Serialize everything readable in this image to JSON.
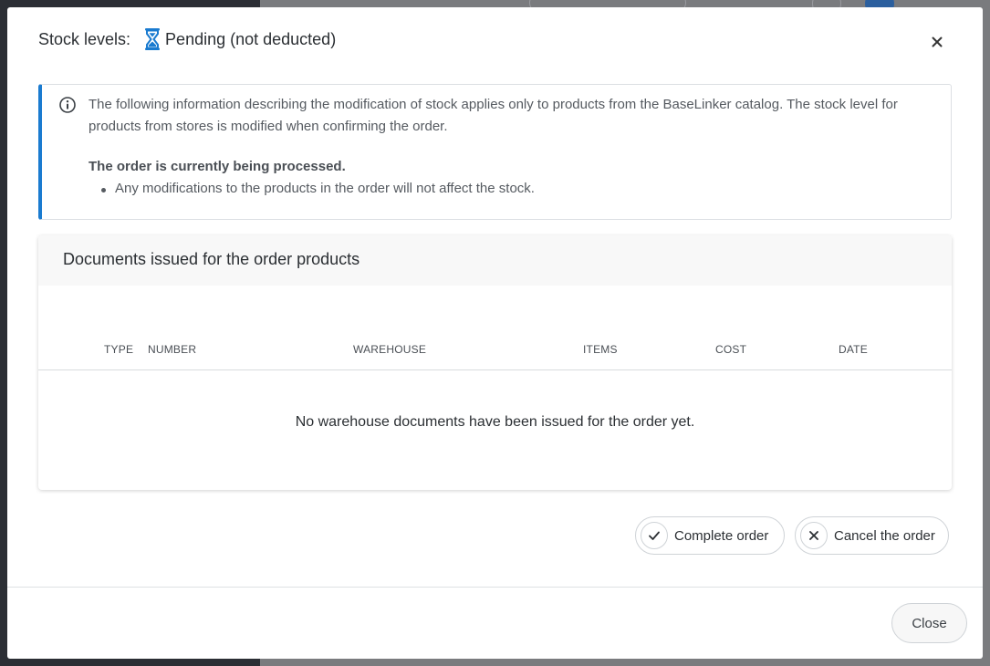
{
  "modal": {
    "title_label": "Stock levels:",
    "status_text": "Pending (not deducted)",
    "status_icon": "hourglass-icon",
    "close_icon": "close-icon"
  },
  "info": {
    "icon": "info-icon",
    "text": "The following information describing the modification of stock applies only to products from the BaseLinker catalog. The stock level for products from stores is modified when confirming the order.",
    "bold": "The order is currently being processed.",
    "bullets": [
      "Any modifications to the products in the order will not affect the stock."
    ]
  },
  "documents": {
    "title": "Documents issued for the order products",
    "columns": [
      "TYPE",
      "NUMBER",
      "WAREHOUSE",
      "ITEMS",
      "COST",
      "DATE"
    ],
    "empty_text": "No warehouse documents have been issued for the order yet."
  },
  "actions": {
    "complete_label": "Complete order",
    "cancel_label": "Cancel the order"
  },
  "footer": {
    "close_label": "Close"
  },
  "colors": {
    "accent": "#1a7bd0",
    "hourglass": "#1a7bd0"
  }
}
